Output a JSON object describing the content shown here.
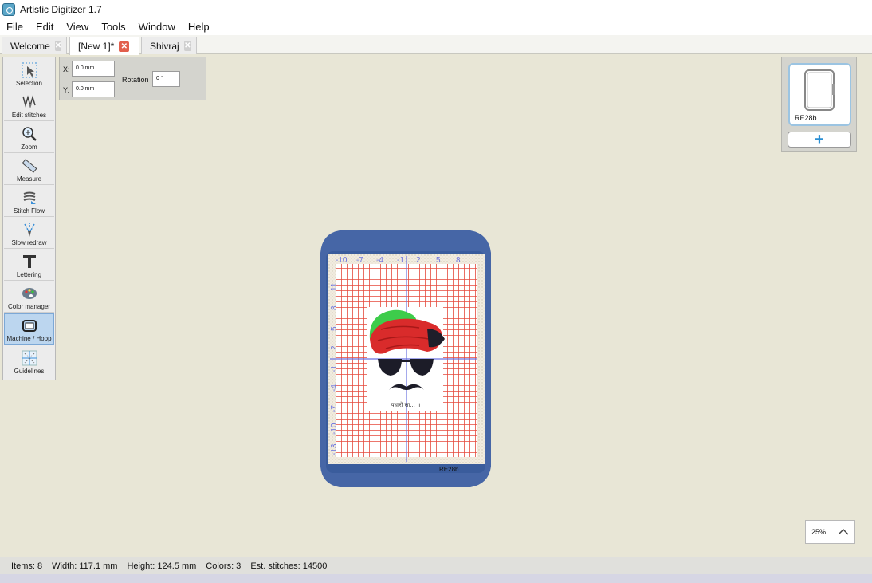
{
  "window": {
    "title": "Artistic Digitizer 1.7"
  },
  "menu": [
    "File",
    "Edit",
    "View",
    "Tools",
    "Window",
    "Help"
  ],
  "tabs": [
    {
      "label": "Welcome",
      "active": false
    },
    {
      "label": "[New 1]*",
      "active": true
    },
    {
      "label": "Shivraj",
      "active": false
    }
  ],
  "tools": [
    {
      "label": "Selection",
      "icon": "selection-arrow-icon"
    },
    {
      "label": "Edit stitches",
      "icon": "edit-stitches-icon"
    },
    {
      "label": "Zoom",
      "icon": "magnifier-icon"
    },
    {
      "label": "Measure",
      "icon": "ruler-icon"
    },
    {
      "label": "Stitch Flow",
      "icon": "stitch-flow-icon"
    },
    {
      "label": "Slow redraw",
      "icon": "slow-redraw-icon"
    },
    {
      "label": "Lettering",
      "icon": "lettering-icon"
    },
    {
      "label": "Color manager",
      "icon": "palette-icon"
    },
    {
      "label": "Machine / Hoop",
      "icon": "hoop-icon",
      "active": true
    },
    {
      "label": "Guidelines",
      "icon": "guidelines-icon"
    }
  ],
  "properties": {
    "x_label": "X:",
    "x_value": "0.0 mm",
    "y_label": "Y:",
    "y_value": "0.0 mm",
    "rotation_label": "Rotation",
    "rotation_value": "0 °"
  },
  "hoop": {
    "label": "RE28b",
    "ruler_top": [
      "-10",
      "-7",
      "-4",
      "-1",
      "2",
      "5",
      "8"
    ],
    "ruler_left": [
      "11",
      "8",
      "5",
      "2",
      "-1",
      "-4",
      "-7",
      "-10",
      "-13"
    ],
    "design_caption": "पधारो सा... ॥"
  },
  "machine_panel": {
    "card_name": "RE28b",
    "add_label": "+"
  },
  "zoom": {
    "value": "25%"
  },
  "status": {
    "items": "Items: 8",
    "width": "Width: 117.1 mm",
    "height": "Height: 124.5 mm",
    "colors": "Colors: 3",
    "stitches": "Est. stitches: 14500"
  },
  "colors": {
    "hoop_frame": "#4666a6",
    "grid_red": "#e5493c",
    "guideline": "#6a72e0",
    "turban_green": "#3dcc4b",
    "turban_red": "#d92b2b",
    "glasses": "#1c1c28",
    "selection_blue": "#bcd6ef"
  }
}
